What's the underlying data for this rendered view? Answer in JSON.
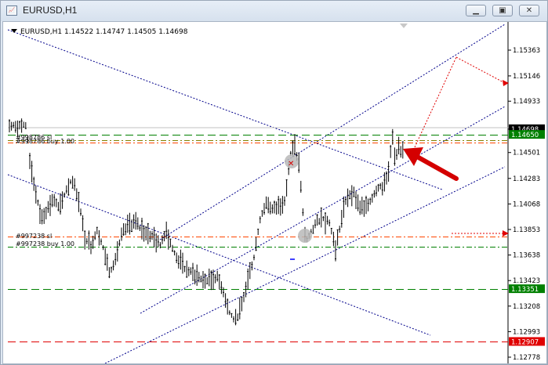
{
  "window": {
    "icon": "chart-window-icon",
    "title": "EURUSD,H1",
    "buttons": {
      "minimize": "minimize-icon",
      "restore": "restore-icon",
      "close": "close-icon"
    }
  },
  "chart_header": {
    "dropdown_icon": "triangle-down-icon",
    "text": "EURUSD,H1  1.14522 1.14747 1.14505 1.14698"
  },
  "order_labels": {
    "upper_sl": "#998786 sl",
    "upper_buy": "#998786 buy 1.00",
    "lower_sl": "#997238 sl",
    "lower_buy": "#997238 buy 1.00"
  },
  "price_axis": {
    "ticks": [
      "1.15363",
      "1.15146",
      "1.14933",
      "1.14698",
      "1.14501",
      "1.14283",
      "1.14068",
      "1.13853",
      "1.13638",
      "1.13423",
      "1.13208",
      "1.12993",
      "1.12778"
    ],
    "badges": [
      {
        "label": "1.14698",
        "value": 1.14698,
        "bg": "#000000",
        "fg": "#ffffff"
      },
      {
        "label": "1.14650",
        "value": 1.1465,
        "bg": "#008000",
        "fg": "#ffffff"
      },
      {
        "label": "1.13351",
        "value": 1.13351,
        "bg": "#008000",
        "fg": "#ffffff"
      },
      {
        "label": "1.12907",
        "value": 1.12907,
        "bg": "#e00000",
        "fg": "#ffffff"
      }
    ]
  },
  "colors": {
    "candles": "#000000",
    "channel": "#00008b",
    "green_level": "#008000",
    "red_level": "#e00000",
    "orange_level": "#ff4500",
    "arrow": "#d40000",
    "marker": "#b8b8b8"
  },
  "chart_data": {
    "type": "candlestick",
    "symbol": "EURUSD",
    "timeframe": "H1",
    "last_bar": {
      "open": 1.14522,
      "high": 1.14747,
      "low": 1.14505,
      "close": 1.14698
    },
    "ylim": [
      1.12778,
      1.15363
    ],
    "horizontal_levels": [
      {
        "price": 1.1465,
        "color": "#008000",
        "style": "long-dash"
      },
      {
        "price": 1.14606,
        "color": "#808000",
        "style": "dash-dot"
      },
      {
        "price": 1.14586,
        "color": "#ff4500",
        "style": "dash-dot"
      },
      {
        "price": 1.13792,
        "color": "#ff4500",
        "style": "dash-dot"
      },
      {
        "price": 1.13705,
        "color": "#008000",
        "style": "dash-dot"
      },
      {
        "price": 1.13351,
        "color": "#008000",
        "style": "long-dash"
      },
      {
        "price": 1.12907,
        "color": "#e00000",
        "style": "long-dash"
      }
    ]
  }
}
